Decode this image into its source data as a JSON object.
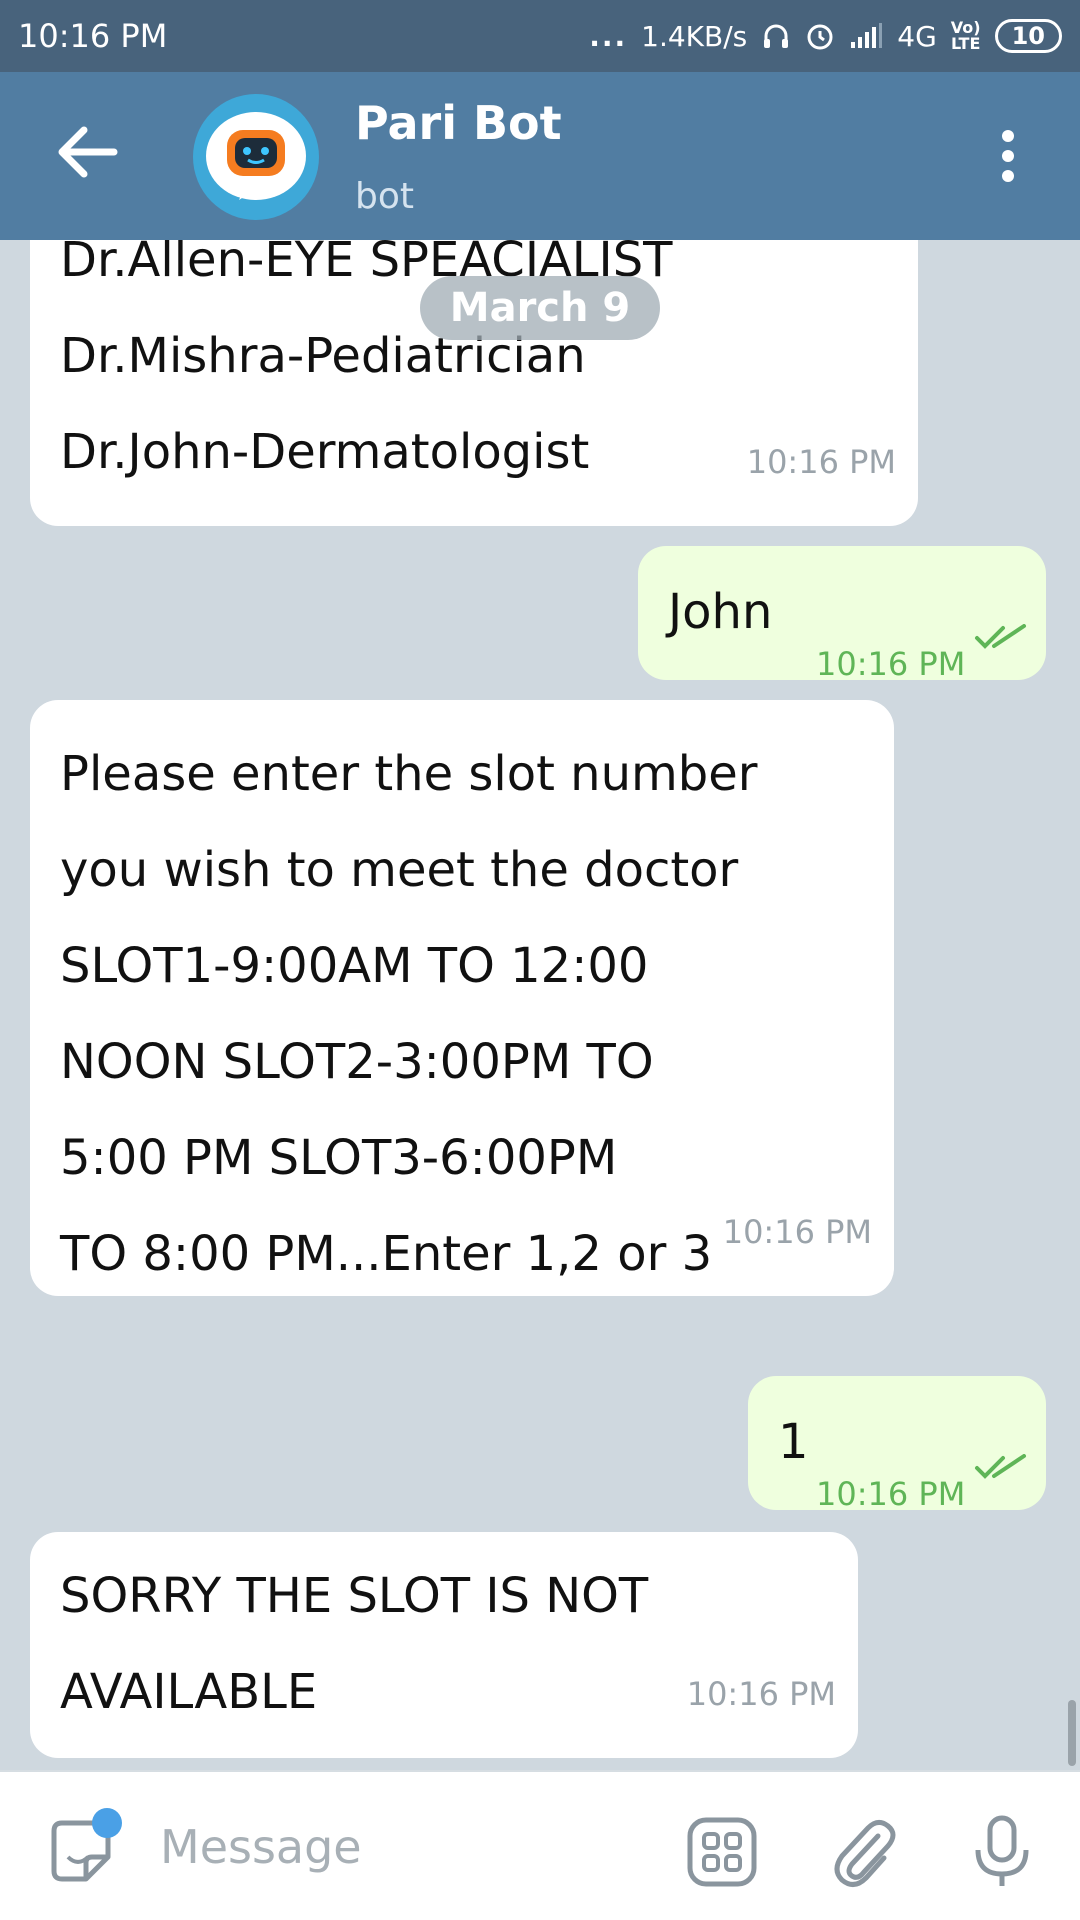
{
  "status_bar": {
    "time": "10:16 PM",
    "dots": "...",
    "speed": "1.4KB/s",
    "network": "4G",
    "volte_top": "Vo)",
    "volte_bottom": "LTE",
    "battery": "10"
  },
  "header": {
    "title": "Pari Bot",
    "subtitle": "bot"
  },
  "chat": {
    "date_label": "March 9",
    "messages": [
      {
        "from": "bot",
        "lines": [
          "Dr.Allen-EYE SPEACIALIST",
          "Dr.Mishra-Pediatrician",
          "Dr.John-Dermatologist"
        ],
        "time": "10:16 PM"
      },
      {
        "from": "me",
        "text": "John",
        "time": "10:16 PM",
        "status": "read"
      },
      {
        "from": "bot",
        "lines": [
          "Please enter the slot number",
          "you wish to meet the doctor",
          "SLOT1-9:00AM TO 12:00",
          "NOON   SLOT2-3:00PM TO",
          "5:00 PM   SLOT3-6:00PM",
          "TO 8:00 PM...Enter 1,2 or 3"
        ],
        "time": "10:16 PM"
      },
      {
        "from": "me",
        "text": "1",
        "time": "10:16 PM",
        "status": "read"
      },
      {
        "from": "bot",
        "lines": [
          "SORRY THE SLOT IS NOT",
          "AVAILABLE"
        ],
        "time": "10:16 PM"
      }
    ]
  },
  "input": {
    "placeholder": "Message"
  },
  "icons": {
    "back": "arrow-left-icon",
    "menu": "more-vertical-icon",
    "sticker": "sticker-icon",
    "bot_commands": "bot-commands-icon",
    "attach": "paperclip-icon",
    "mic": "microphone-icon"
  },
  "colors": {
    "header": "#517da2",
    "status_bar": "#48637c",
    "incoming": "#ffffff",
    "outgoing": "#efffde",
    "read_check": "#5fb557"
  }
}
